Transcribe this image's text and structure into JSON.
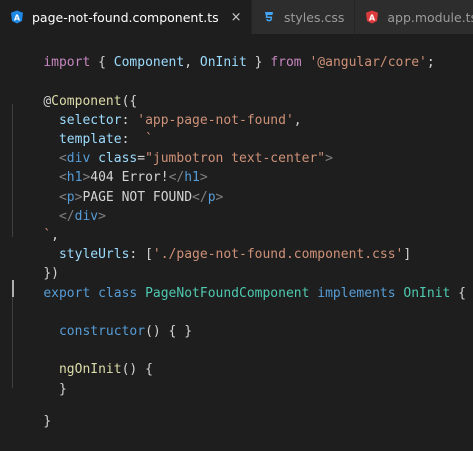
{
  "tabs": [
    {
      "label": "page-not-found.component.ts",
      "icon": "angular-ts-icon",
      "active": true,
      "close": "×"
    },
    {
      "label": "styles.css",
      "icon": "css-icon",
      "active": false
    },
    {
      "label": "app.module.ts",
      "icon": "angular-icon",
      "active": false
    }
  ],
  "colors": {
    "keyword": "#c586c0",
    "keyword_blue": "#569cd6",
    "class": "#4ec9b0",
    "string": "#ce9178",
    "property": "#9cdcfe",
    "function": "#dcdcaa"
  },
  "code": {
    "l1": {
      "t1": "import",
      "t2": " { ",
      "t3": "Component",
      "t4": ", ",
      "t5": "OnInit",
      "t6": " } ",
      "t7": "from",
      "t8": " ",
      "t9": "'@angular/core'",
      "t10": ";"
    },
    "l3": {
      "t1": "@",
      "t2": "Component",
      "t3": "({"
    },
    "l4": {
      "t1": "  ",
      "t2": "selector",
      "t3": ": ",
      "t4": "'app-page-not-found'",
      "t5": ","
    },
    "l5": {
      "t1": "  ",
      "t2": "template",
      "t3": ":  ",
      "t4": "`"
    },
    "l6": {
      "t1": "  ",
      "t2": "<",
      "t3": "div",
      "t4": " ",
      "t5": "class",
      "t6": "=",
      "t7": "\"jumbotron text-center\"",
      "t8": ">"
    },
    "l7": {
      "t1": "  ",
      "t2": "<",
      "t3": "h1",
      "t4": ">",
      "t5": "404 Error!",
      "t6": "</",
      "t7": "h1",
      "t8": ">"
    },
    "l8": {
      "t1": "  ",
      "t2": "<",
      "t3": "p",
      "t4": ">",
      "t5": "PAGE NOT FOUND",
      "t6": "</",
      "t7": "p",
      "t8": ">"
    },
    "l9": {
      "t1": "  ",
      "t2": "</",
      "t3": "div",
      "t4": ">"
    },
    "l10": {
      "t1": "`",
      "t2": ","
    },
    "l11": {
      "t1": "  ",
      "t2": "styleUrls",
      "t3": ": [",
      "t4": "'./page-not-found.component.css'",
      "t5": "]"
    },
    "l12": {
      "t1": "})"
    },
    "l13": {
      "t1": "export",
      "t2": " ",
      "t3": "class",
      "t4": " ",
      "t5": "PageNotFoundComponent",
      "t6": " ",
      "t7": "implements",
      "t8": " ",
      "t9": "OnInit",
      "t10": " {"
    },
    "l15": {
      "t1": "  ",
      "t2": "constructor",
      "t3": "() { }"
    },
    "l17": {
      "t1": "  ",
      "t2": "ngOnInit",
      "t3": "() {"
    },
    "l18": {
      "t1": "  }"
    },
    "l20": {
      "t1": "}"
    }
  }
}
